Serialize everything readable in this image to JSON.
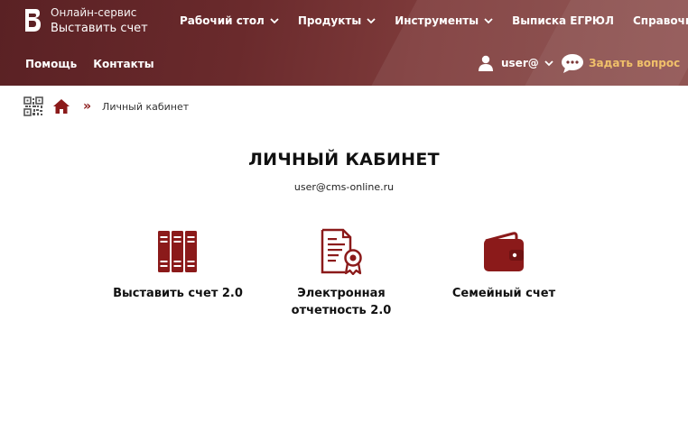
{
  "brand": {
    "line1": "Онлайн-сервис",
    "line2": "Выставить счет"
  },
  "topnav": [
    {
      "label": "Рабочий стол",
      "dropdown": true
    },
    {
      "label": "Продукты",
      "dropdown": true
    },
    {
      "label": "Инструменты",
      "dropdown": true
    },
    {
      "label": "Выписка ЕГРЮЛ",
      "dropdown": false
    },
    {
      "label": "Справочники",
      "dropdown": true
    }
  ],
  "subnav": [
    {
      "label": "Помощь"
    },
    {
      "label": "Контакты"
    }
  ],
  "user": {
    "name": "user@"
  },
  "ask": {
    "label": "Задать вопрос"
  },
  "breadcrumb": {
    "separator": "»",
    "current": "Личный кабинет"
  },
  "page": {
    "title": "ЛИЧНЫЙ КАБИНЕТ",
    "email": "user@cms-online.ru"
  },
  "cards": [
    {
      "label": "Выставить счет 2.0",
      "icon": "binders-icon"
    },
    {
      "label": "Электронная отчетность 2.0",
      "icon": "certificate-document-icon"
    },
    {
      "label": "Семейный счет",
      "icon": "wallet-icon"
    }
  ],
  "colors": {
    "header": "#6a2a2c",
    "accent": "#8b1a1a",
    "link": "#f0c06a"
  }
}
